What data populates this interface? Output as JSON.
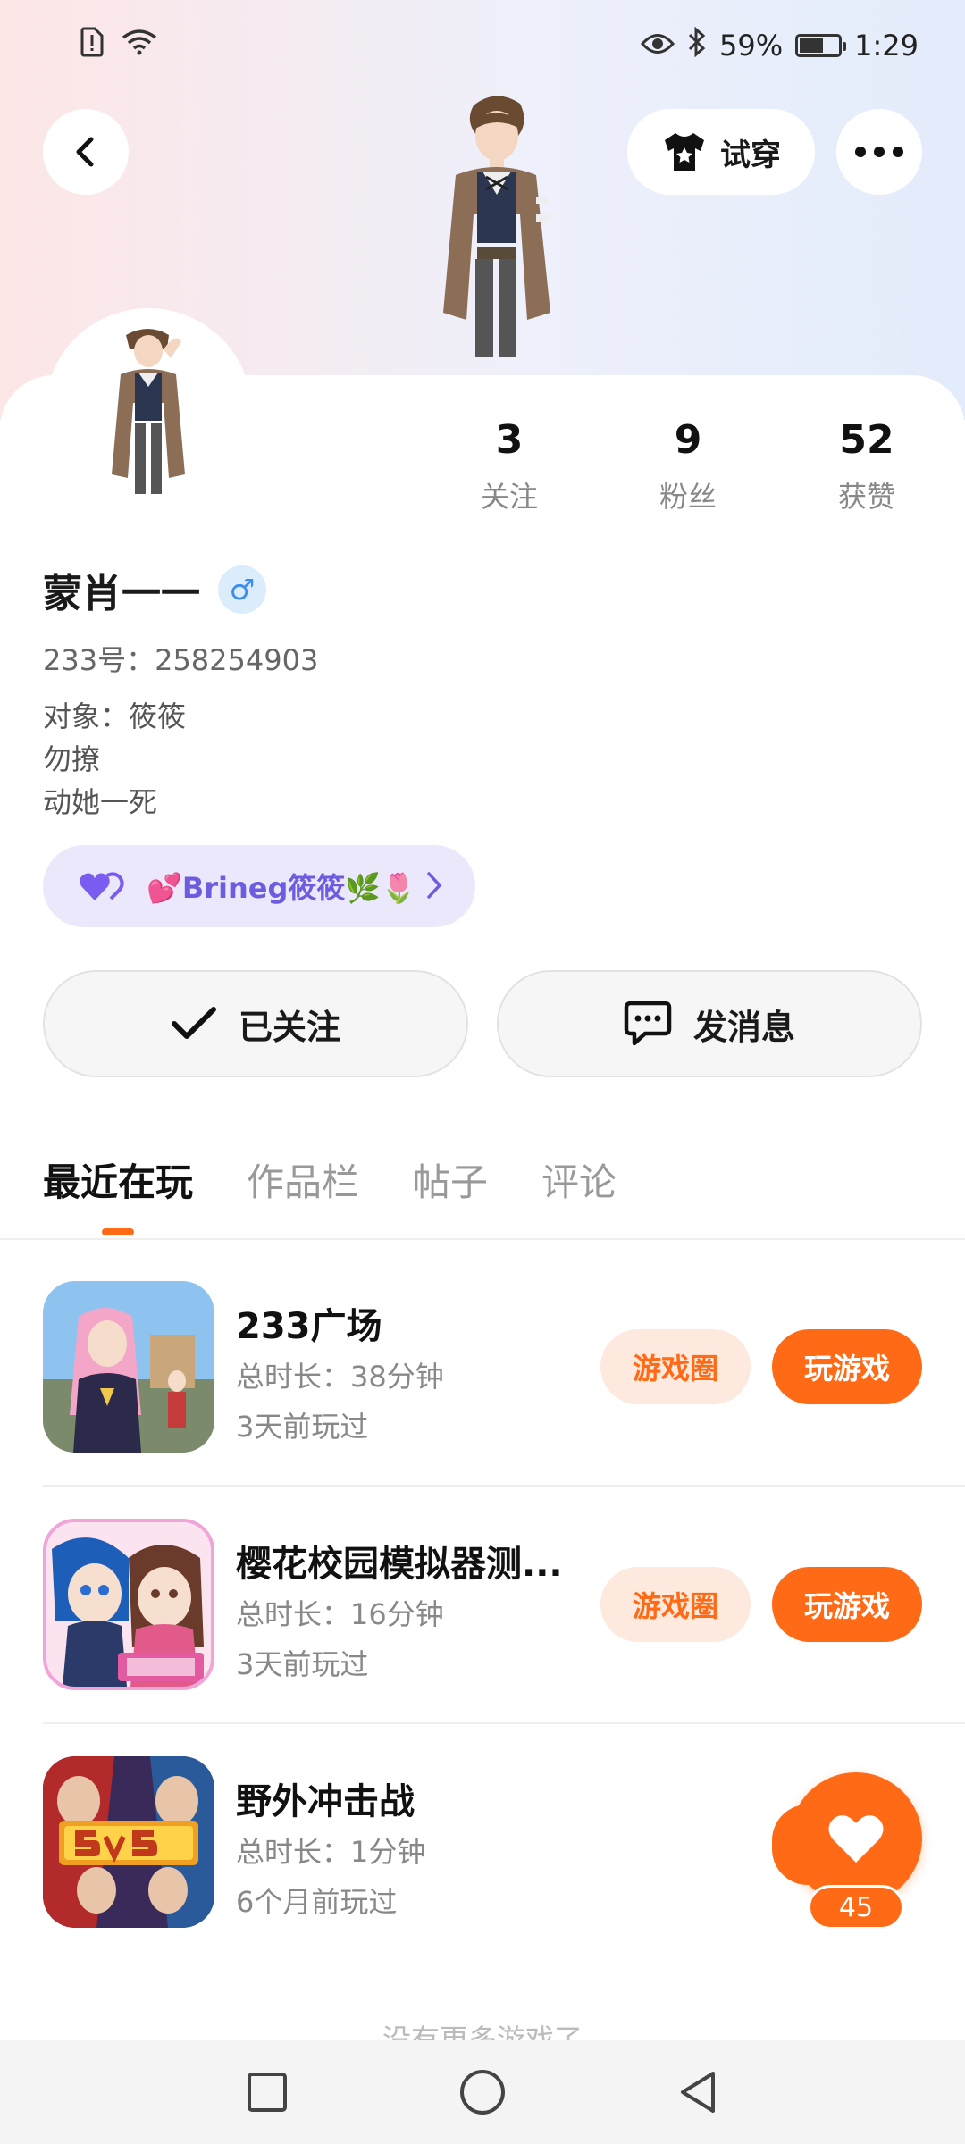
{
  "status_bar": {
    "battery": "59%",
    "time": "1:29",
    "battery_level": 0.59
  },
  "header": {
    "try_on_label": "试穿"
  },
  "profile": {
    "stats": [
      {
        "value": "3",
        "label": "关注"
      },
      {
        "value": "9",
        "label": "粉丝"
      },
      {
        "value": "52",
        "label": "获赞"
      }
    ],
    "name": "蒙肖一一",
    "gender_symbol": "♂",
    "uid": "233号：258254903",
    "bio": [
      "对象：筱筱",
      "勿撩",
      "动她一死"
    ],
    "couple_tag": "💕Brineg筱筱🌿🌷"
  },
  "actions": {
    "follow_label": "已关注",
    "message_label": "发消息"
  },
  "tabs": [
    {
      "label": "最近在玩",
      "active": true
    },
    {
      "label": "作品栏",
      "active": false
    },
    {
      "label": "帖子",
      "active": false
    },
    {
      "label": "评论",
      "active": false
    }
  ],
  "games": [
    {
      "title": "233广场",
      "duration": "总时长：38分钟",
      "last_played": "3天前玩过",
      "circle_label": "游戏圈",
      "play_label": "玩游戏"
    },
    {
      "title": "樱花校园模拟器测...",
      "duration": "总时长：16分钟",
      "last_played": "3天前玩过",
      "circle_label": "游戏圈",
      "play_label": "玩游戏"
    },
    {
      "title": "野外冲击战",
      "duration": "总时长：1分钟",
      "last_played": "6个月前玩过"
    }
  ],
  "like": {
    "count": "45"
  },
  "footer": {
    "no_more": "没有更多游戏了"
  },
  "colors": {
    "accent": "#ff6a16",
    "accent_light": "#fde9dd",
    "couple_bg": "#ece8fb",
    "couple_text": "#6c5ce0",
    "gender_blue": "#3d8cf0"
  },
  "game_icons": [
    "233-plaza-game-icon",
    "sakura-school-game-icon",
    "5v5-battle-game-icon"
  ]
}
